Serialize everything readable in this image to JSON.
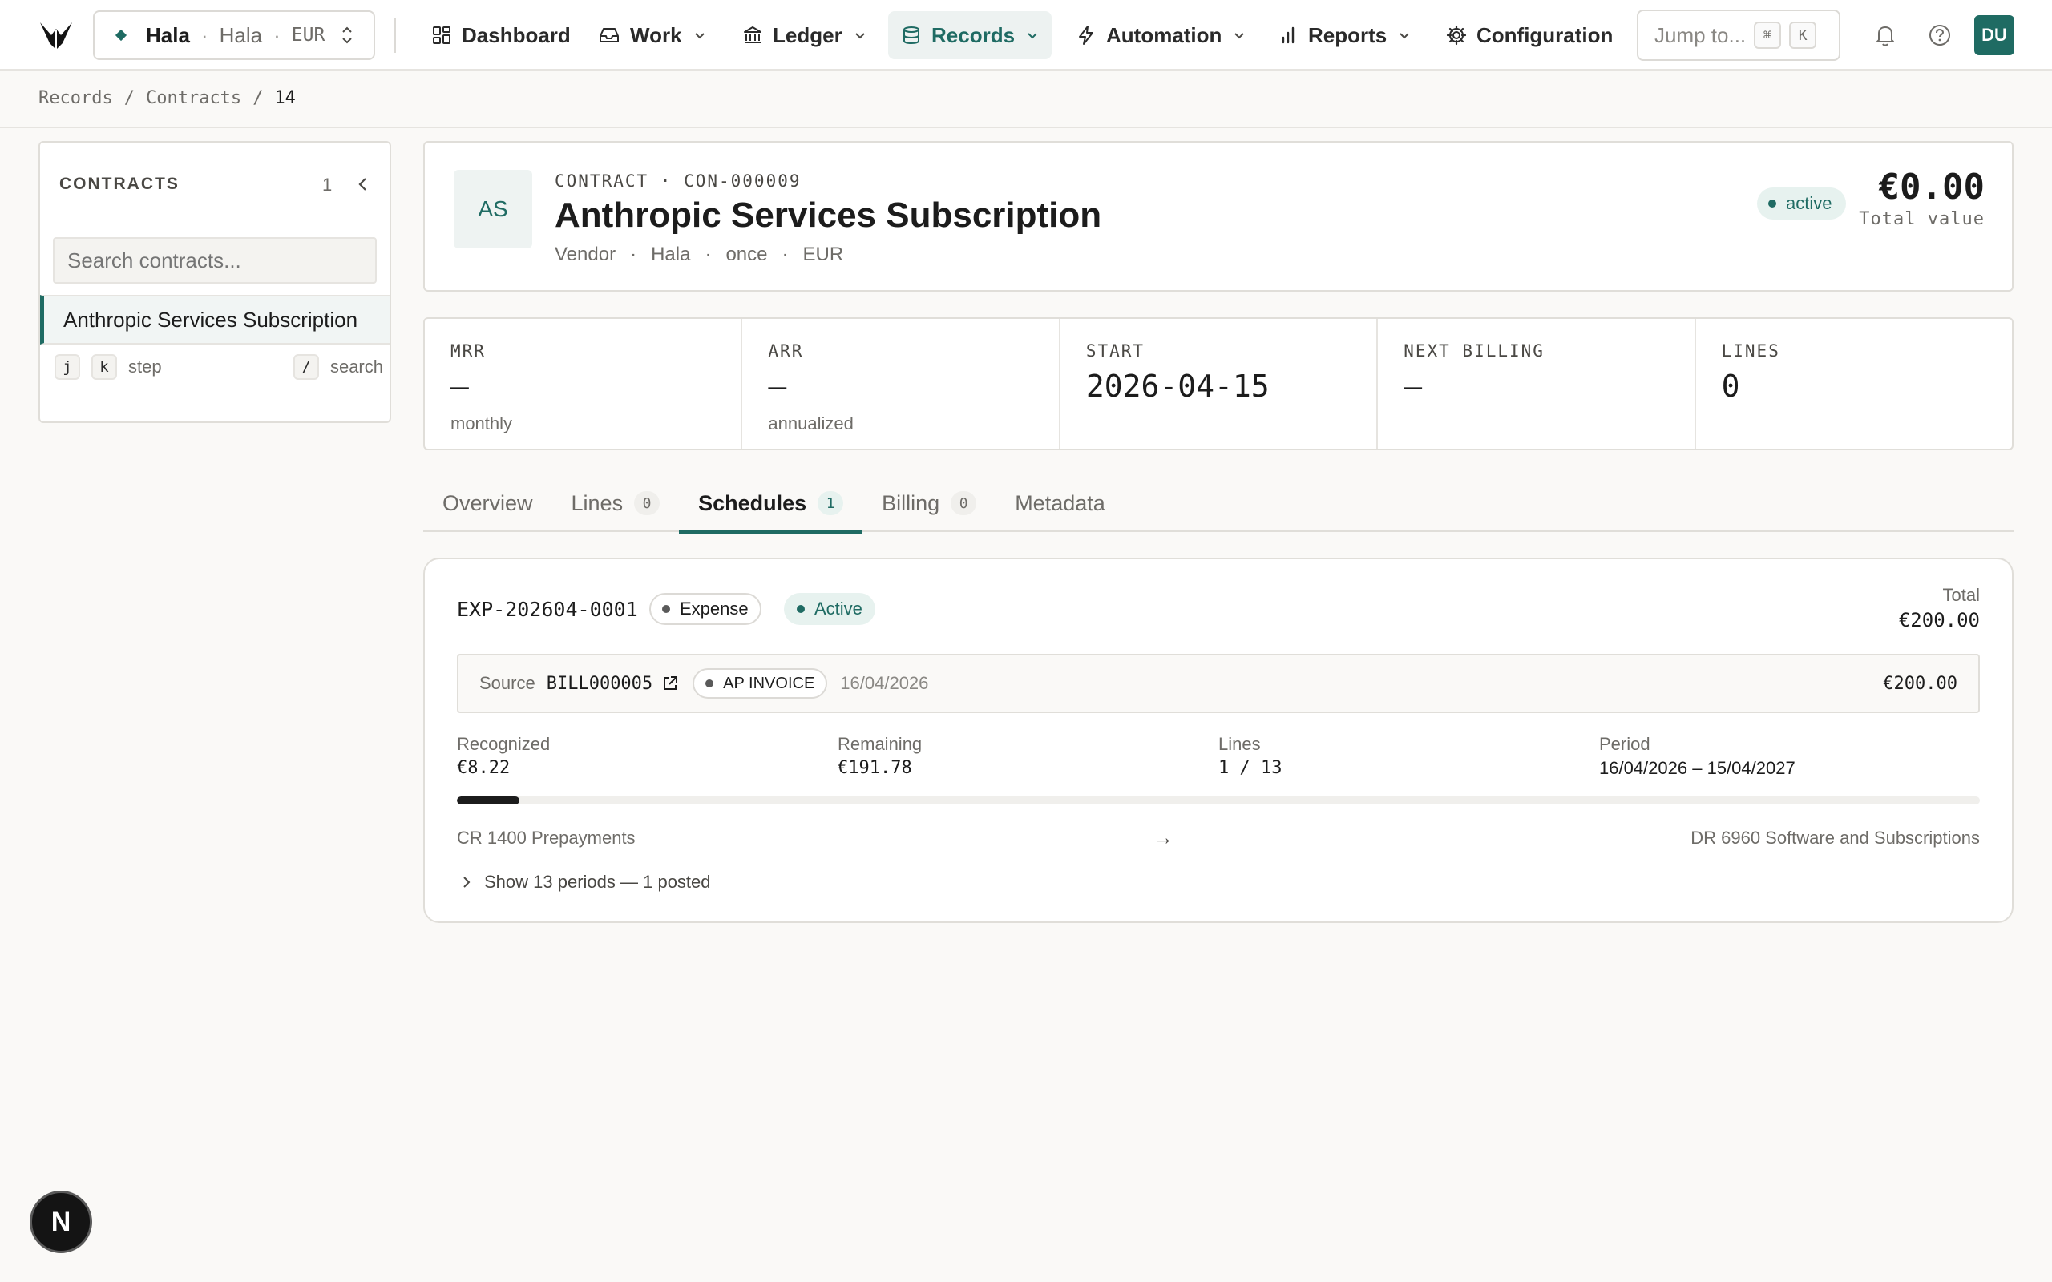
{
  "org_switcher": {
    "name": "Hala",
    "entity": "Hala",
    "currency": "EUR"
  },
  "nav": {
    "items": [
      {
        "label": "Dashboard",
        "icon": "dashboard-icon"
      },
      {
        "label": "Work",
        "icon": "inbox-icon"
      },
      {
        "label": "Ledger",
        "icon": "bank-icon"
      },
      {
        "label": "Records",
        "icon": "database-icon"
      },
      {
        "label": "Automation",
        "icon": "bolt-icon"
      },
      {
        "label": "Reports",
        "icon": "bar-chart-icon"
      },
      {
        "label": "Configuration",
        "icon": "gear-icon"
      }
    ],
    "active": "Records",
    "jump_placeholder": "Jump to...",
    "jump_keys": [
      "⌘",
      "K"
    ],
    "avatar_initials": "DU"
  },
  "breadcrumb": {
    "items": [
      "Records",
      "Contracts"
    ],
    "current": "14",
    "separator": "/"
  },
  "sidebar": {
    "title": "CONTRACTS",
    "count": "1",
    "search_placeholder": "Search contracts...",
    "items": [
      {
        "label": "Anthropic Services Subscription"
      }
    ],
    "hints": {
      "step_keys": [
        "j",
        "k"
      ],
      "step_label": "step",
      "search_key": "/",
      "search_label": "search"
    }
  },
  "contract": {
    "initials": "AS",
    "kicker": "CONTRACT · CON-000009",
    "title": "Anthropic Services Subscription",
    "meta": [
      "Vendor",
      "Hala",
      "once",
      "EUR"
    ],
    "meta_separator": "·",
    "status": "active",
    "total_value": "€0.00",
    "total_label": "Total value"
  },
  "stats": [
    {
      "label": "MRR",
      "value": "—",
      "sub": "monthly"
    },
    {
      "label": "ARR",
      "value": "—",
      "sub": "annualized"
    },
    {
      "label": "START",
      "value": "2026-04-15",
      "sub": ""
    },
    {
      "label": "NEXT BILLING",
      "value": "—",
      "sub": ""
    },
    {
      "label": "LINES",
      "value": "0",
      "sub": ""
    }
  ],
  "tabs": [
    {
      "label": "Overview",
      "badge": ""
    },
    {
      "label": "Lines",
      "badge": "0"
    },
    {
      "label": "Schedules",
      "badge": "1"
    },
    {
      "label": "Billing",
      "badge": "0"
    },
    {
      "label": "Metadata",
      "badge": ""
    }
  ],
  "active_tab": "Schedules",
  "schedule": {
    "id": "EXP-202604-0001",
    "type": "Expense",
    "status": "Active",
    "total_label": "Total",
    "total_value": "€200.00",
    "source": {
      "label": "Source",
      "ref": "BILL000005",
      "doc_type": "AP INVOICE",
      "date": "16/04/2026",
      "amount": "€200.00"
    },
    "metrics": [
      {
        "label": "Recognized",
        "value": "€8.22"
      },
      {
        "label": "Remaining",
        "value": "€191.78"
      },
      {
        "label": "Lines",
        "value": "1 / 13"
      },
      {
        "label": "Period",
        "value": "16/04/2026 – 15/04/2027"
      }
    ],
    "progress_fraction": 0.041,
    "credit_account": "CR 1400 Prepayments",
    "arrow": "→",
    "debit_account": "DR 6960 Software and Subscriptions",
    "periods_toggle": "Show 13 periods — 1 posted"
  },
  "colors": {
    "accent": "#1f6b63",
    "accent_bg": "#e7f2ef",
    "background": "#faf9f7",
    "border": "#e0ded9",
    "muted_text": "#6e6c68",
    "expense_dot": "#5a5a5a"
  },
  "dev_badge": "N"
}
